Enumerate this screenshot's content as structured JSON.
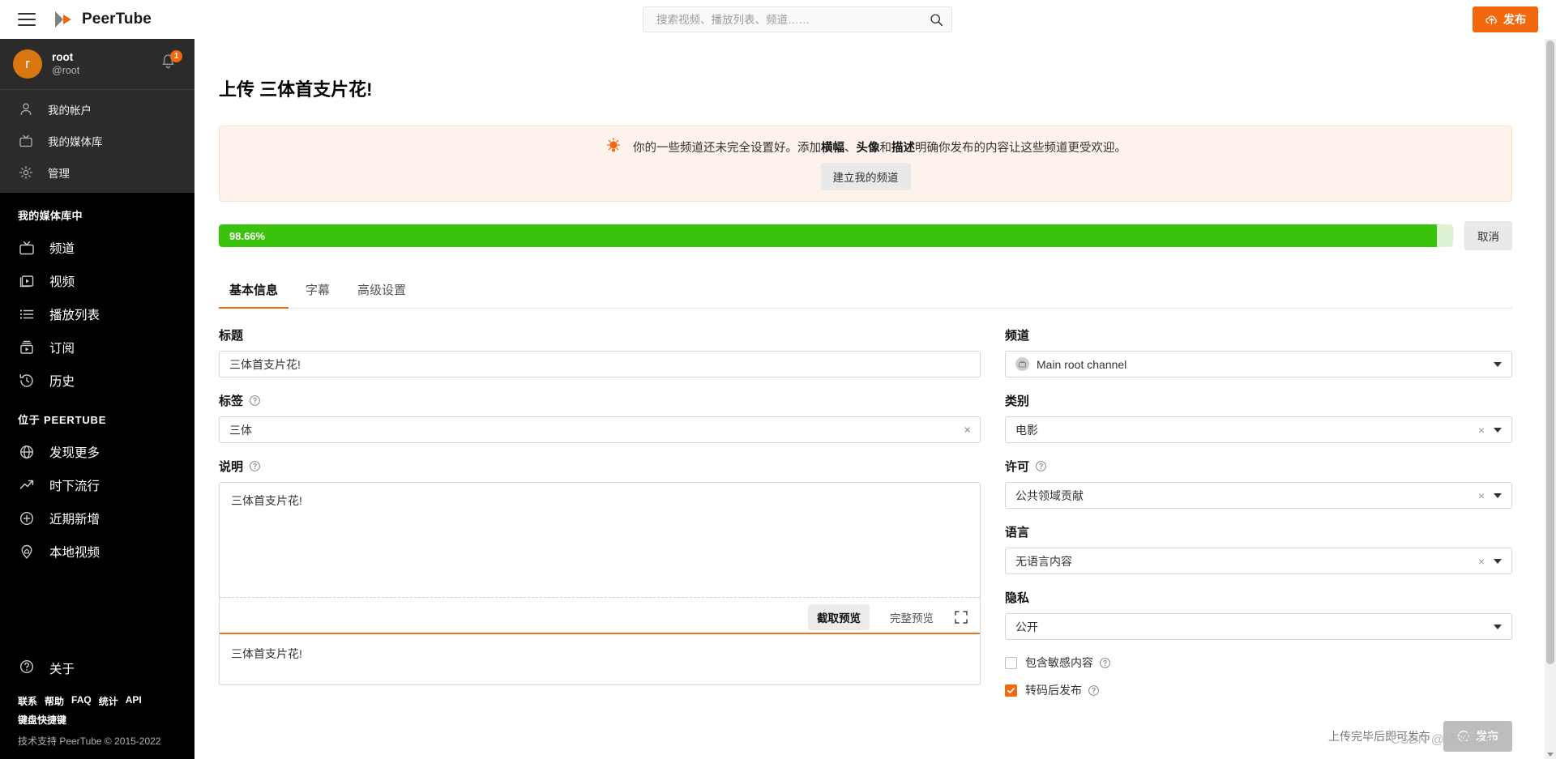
{
  "header": {
    "menu_icon": "hamburger-icon",
    "brand": "PeerTube",
    "search": {
      "placeholder": "搜索视频、播放列表、频道……",
      "value": "",
      "icon": "search-icon"
    },
    "publish_button": {
      "label": "发布",
      "icon": "upload-cloud-icon",
      "color": "#f1680d"
    }
  },
  "sidebar": {
    "user": {
      "avatar_initial": "r",
      "display_name": "root",
      "handle": "@root",
      "avatar_color": "#d9760f",
      "notification_count": "1",
      "bell_icon": "bell-icon"
    },
    "account_items": [
      {
        "label": "我的帐户",
        "icon": "person-icon"
      },
      {
        "label": "我的媒体库",
        "icon": "tv-icon"
      },
      {
        "label": "管理",
        "icon": "gear-icon"
      }
    ],
    "library_section_title": "我的媒体库中",
    "library_items": [
      {
        "label": "频道",
        "icon": "tv-icon"
      },
      {
        "label": "视频",
        "icon": "video-stack-icon"
      },
      {
        "label": "播放列表",
        "icon": "playlist-icon"
      },
      {
        "label": "订阅",
        "icon": "subscriptions-icon"
      },
      {
        "label": "历史",
        "icon": "history-icon"
      }
    ],
    "peertube_section_title": "位于 PEERTUBE",
    "peertube_items": [
      {
        "label": "发现更多",
        "icon": "globe-icon"
      },
      {
        "label": "时下流行",
        "icon": "trending-icon"
      },
      {
        "label": "近期新增",
        "icon": "plus-circle-icon"
      },
      {
        "label": "本地视频",
        "icon": "map-pin-icon"
      }
    ],
    "about": {
      "label": "关于",
      "icon": "question-circle-icon"
    },
    "footer_links": [
      "联系",
      "帮助",
      "FAQ",
      "统计",
      "API"
    ],
    "keyboard_shortcuts": "键盘快捷键",
    "copyright": "技术支持 PeerTube © 2015-2022"
  },
  "main": {
    "page_title": "上传 三体首支片花!",
    "alert": {
      "icon": "lightbulb-icon",
      "text_part1": "你的一些频道还未完全设置好。添加",
      "bold1": "横幅",
      "text_part2": "、",
      "bold2": "头像",
      "text_part3": "和",
      "bold3": "描述",
      "text_part4": "明确你发布的内容让这些频道更受欢迎。",
      "button_label": "建立我的频道",
      "bg_color": "#fdf3ec"
    },
    "upload": {
      "progress_percent": "98.66%",
      "progress_value": 98.66,
      "bar_color": "#3ac30d",
      "cancel_label": "取消"
    },
    "tabs": [
      {
        "label": "基本信息",
        "active": true
      },
      {
        "label": "字幕",
        "active": false
      },
      {
        "label": "高级设置",
        "active": false
      }
    ],
    "form": {
      "title": {
        "label": "标题",
        "value": "三体首支片花!"
      },
      "tags": {
        "label": "标签",
        "value": "三体",
        "help_icon": "question-circle-icon",
        "clear_icon": "close-icon"
      },
      "description": {
        "label": "说明",
        "help_icon": "question-circle-icon",
        "value": "三体首支片花!",
        "preview_value": "三体首支片花!",
        "toolbar": {
          "truncated_label": "截取预览",
          "complete_label": "完整预览",
          "expand_icon": "maximize-icon"
        }
      },
      "channel": {
        "label": "频道",
        "value": "Main root channel",
        "icon": "channel-avatar-icon"
      },
      "category": {
        "label": "类别",
        "value": "电影",
        "clearable": true
      },
      "license": {
        "label": "许可",
        "value": "公共领域贡献",
        "help_icon": "question-circle-icon",
        "clearable": true
      },
      "language": {
        "label": "语言",
        "value": "无语言内容",
        "clearable": true
      },
      "privacy": {
        "label": "隐私",
        "value": "公开",
        "clearable": false
      },
      "sensitive": {
        "label": "包含敏感内容",
        "checked": false,
        "help_icon": "question-circle-icon"
      },
      "wait_transcoding": {
        "label": "转码后发布",
        "checked": true,
        "help_icon": "question-circle-icon"
      }
    },
    "publish": {
      "note": "上传完毕后即可发布",
      "button_label": "发布",
      "button_icon": "check-circle-icon",
      "disabled": true
    },
    "watermark": "CSDN @杨浦老苏"
  }
}
